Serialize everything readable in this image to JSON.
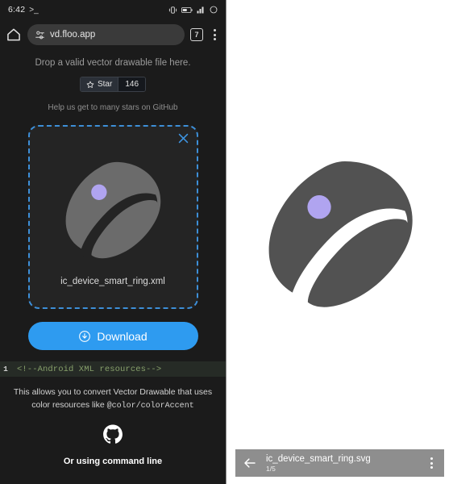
{
  "colors": {
    "accent_blue": "#2e9bf0",
    "dashed_border": "#3d8fd8",
    "panel_dark": "#1b1b1b",
    "card_dark": "#242424",
    "ring_gray_light": "#525252",
    "ring_gray_dark": "#6b6b6b",
    "dot_purple": "#b0a4f0",
    "code_green": "#87a06b",
    "preview_bar": "#8e8e8e"
  },
  "status_bar": {
    "time": "6:42",
    "shell_glyph": ">_",
    "icons": [
      "vibrate-icon",
      "battery-icon",
      "signal-icon",
      "circle-icon"
    ]
  },
  "toolbar": {
    "home_icon": "home-icon",
    "lock_icon": "site-settings-icon",
    "url": "vd.floo.app",
    "tab_count": "7",
    "menu_icon": "overflow-menu-icon"
  },
  "page": {
    "drop_hint": "Drop a valid vector drawable file here.",
    "star_label": "Star",
    "star_count": "146",
    "help_text": "Help us get to many stars on GitHub",
    "file_name": "ic_device_smart_ring.xml",
    "close_label": "close-icon",
    "download_label": "Download",
    "download_icon": "download-circle-icon",
    "code_line_number": "1",
    "code_text": "<!--Android XML resources-->",
    "description_line1": "This allows you to convert Vector Drawable that uses color",
    "description_line2_prefix": "resources like ",
    "description_line2_code": "@color/colorAccent",
    "github_icon": "github-icon",
    "command_line_heading": "Or using command line"
  },
  "preview": {
    "back_icon": "back-arrow-icon",
    "title": "ic_device_smart_ring.svg",
    "page_indicator": "1/5",
    "menu_icon": "overflow-menu-icon"
  }
}
